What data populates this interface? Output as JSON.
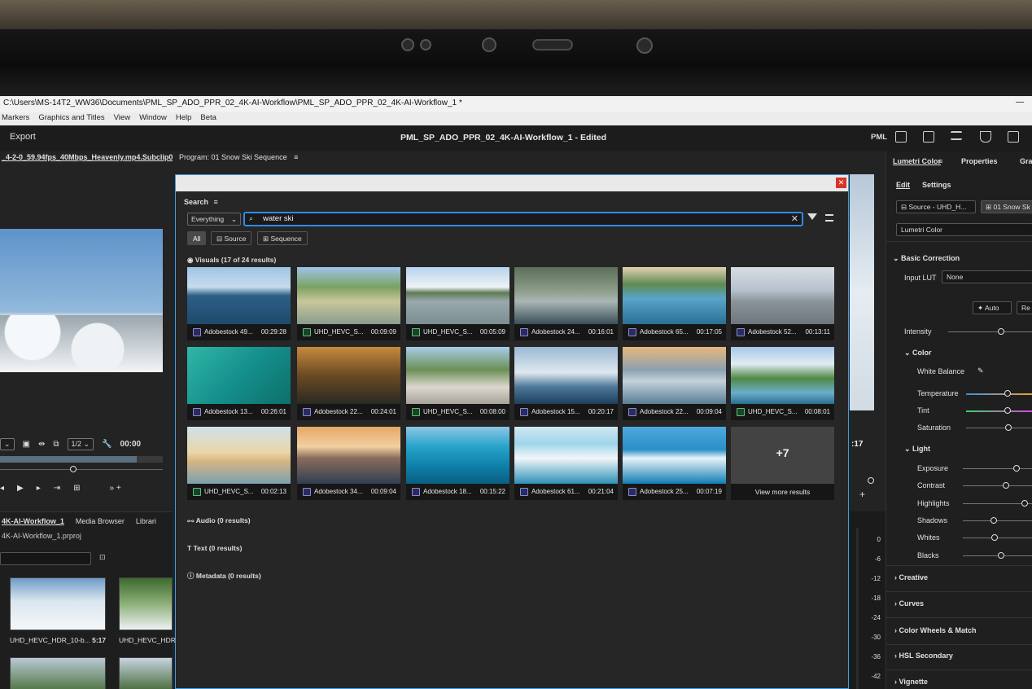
{
  "window": {
    "path": "C:\\Users\\MS-14T2_WW36\\Documents\\PML_SP_ADO_PPR_02_4K-AI-Workflow\\PML_SP_ADO_PPR_02_4K-AI-Workflow_1 *"
  },
  "menu": [
    "Markers",
    "Graphics and Titles",
    "View",
    "Window",
    "Help",
    "Beta"
  ],
  "appbar": {
    "export": "Export",
    "project_title": "PML_SP_ADO_PPR_02_4K-AI-Workflow_1 - Edited",
    "user": "PML"
  },
  "source": {
    "clip_tab": "_4-2-0_59.94fps_40Mbps_Heavenly.mp4.Subclip0",
    "chevrons": "»",
    "resolution": "1/2",
    "timecode": "00:00"
  },
  "program": {
    "title": "Program: 01 Snow Ski Sequence",
    "timecode_tail": ":17"
  },
  "project": {
    "tabs": [
      "4K-AI-Workflow_1",
      "Media Browser",
      "Librari"
    ],
    "file": "4K-AI-Workflow_1.prproj",
    "thumbs": [
      {
        "name": "UHD_HEVC_HDR_10-b...",
        "duration": "5:17"
      },
      {
        "name": "UHD_HEVC_HDR",
        "duration": ""
      }
    ]
  },
  "search": {
    "title": "Search",
    "scope": "Everything",
    "query": "water ski",
    "chips": [
      "All",
      "Source",
      "Sequence"
    ],
    "visuals_label": "Visuals (17 of 24 results)",
    "audio_label": "Audio (0 results)",
    "text_label": "Text (0 results)",
    "metadata_label": "Metadata (0 results)",
    "more_count": "+7",
    "more_label": "View more results",
    "results": [
      {
        "name": "Adobestock 49...",
        "duration": "00:29:28",
        "kind": "stock"
      },
      {
        "name": "UHD_HEVC_S...",
        "duration": "00:09:09",
        "kind": "seq"
      },
      {
        "name": "UHD_HEVC_S...",
        "duration": "00:05:09",
        "kind": "seq"
      },
      {
        "name": "Adobestock 24...",
        "duration": "00:16:01",
        "kind": "stock"
      },
      {
        "name": "Adobestock 65...",
        "duration": "00:17:05",
        "kind": "stock"
      },
      {
        "name": "Adobestock 52...",
        "duration": "00:13:11",
        "kind": "stock"
      },
      {
        "name": "Adobestock 13...",
        "duration": "00:26:01",
        "kind": "stock"
      },
      {
        "name": "Adobestock 22...",
        "duration": "00:24:01",
        "kind": "stock"
      },
      {
        "name": "UHD_HEVC_S...",
        "duration": "00:08:00",
        "kind": "seq"
      },
      {
        "name": "Adobestock 15...",
        "duration": "00:20:17",
        "kind": "stock"
      },
      {
        "name": "Adobestock 22...",
        "duration": "00:09:04",
        "kind": "stock"
      },
      {
        "name": "UHD_HEVC_S...",
        "duration": "00:08:01",
        "kind": "seq"
      },
      {
        "name": "UHD_HEVC_S...",
        "duration": "00:02:13",
        "kind": "seq"
      },
      {
        "name": "Adobestock 34...",
        "duration": "00:09:04",
        "kind": "stock"
      },
      {
        "name": "Adobestock 18...",
        "duration": "00:15:22",
        "kind": "stock"
      },
      {
        "name": "Adobestock 61...",
        "duration": "00:21:04",
        "kind": "stock"
      },
      {
        "name": "Adobestock 25...",
        "duration": "00:07:19",
        "kind": "stock"
      }
    ]
  },
  "lumetri": {
    "tabs": [
      "Lumetri Color",
      "Properties",
      "Grap"
    ],
    "subtabs": [
      "Edit",
      "Settings"
    ],
    "source_btn": "Source - UHD_H...",
    "seq_btn": "01 Snow Sk",
    "effect": "Lumetri Color",
    "basic": "Basic Correction",
    "input_lut": "Input LUT",
    "lut_value": "None",
    "auto": "Auto",
    "reset": "Re",
    "intensity": "Intensity",
    "color": "Color",
    "white_balance": "White Balance",
    "temperature": "Temperature",
    "tint": "Tint",
    "saturation": "Saturation",
    "light": "Light",
    "exposure": "Exposure",
    "contrast": "Contrast",
    "highlights": "Highlights",
    "shadows": "Shadows",
    "whites": "Whites",
    "blacks": "Blacks",
    "creative": "Creative",
    "curves": "Curves",
    "color_wheels": "Color Wheels & Match",
    "hsl": "HSL Secondary",
    "vignette": "Vignette"
  },
  "meter": {
    "labels": [
      "0",
      "-6",
      "-12",
      "-18",
      "-24",
      "-30",
      "-36",
      "-42"
    ]
  },
  "colors": {
    "accent": "#2d8ceb",
    "close": "#d9342b",
    "panel": "#262626"
  }
}
